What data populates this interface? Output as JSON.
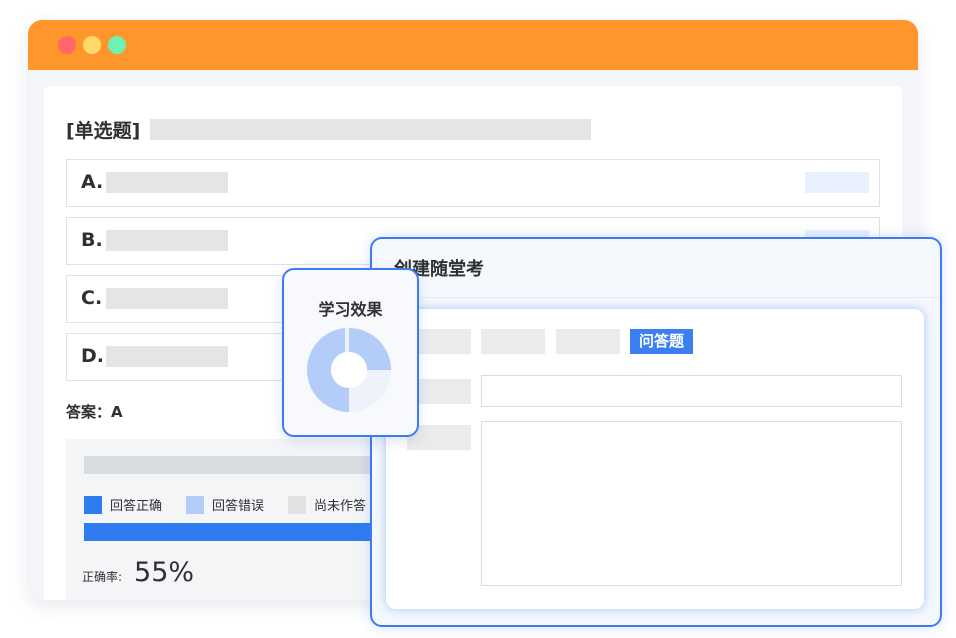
{
  "window": {
    "controls": [
      "close",
      "minimize",
      "maximize"
    ]
  },
  "question": {
    "type_label": "[单选题]",
    "options": [
      {
        "letter": "A."
      },
      {
        "letter": "B."
      },
      {
        "letter": "C."
      },
      {
        "letter": "D."
      }
    ],
    "answer_label": "答案：A"
  },
  "stats": {
    "legend": [
      {
        "label": "回答正确",
        "color": "#2f7bf0"
      },
      {
        "label": "回答错误",
        "color": "#b3cdf8"
      },
      {
        "label": "尚未作答",
        "color": "#e2e2e2"
      }
    ],
    "accuracy_label": "正确率:",
    "accuracy_value": "55%"
  },
  "effect_card": {
    "title": "学习效果",
    "icon": "donut-chart-icon",
    "segments": [
      {
        "color": "#b3cdf8",
        "value": 0.5
      },
      {
        "color": "#eef2fa",
        "value": 0.5
      }
    ]
  },
  "dialog": {
    "title": "创建随堂考",
    "active_tab": "问答题"
  },
  "colors": {
    "accent": "#fe962b",
    "primary": "#2f7bf0"
  }
}
